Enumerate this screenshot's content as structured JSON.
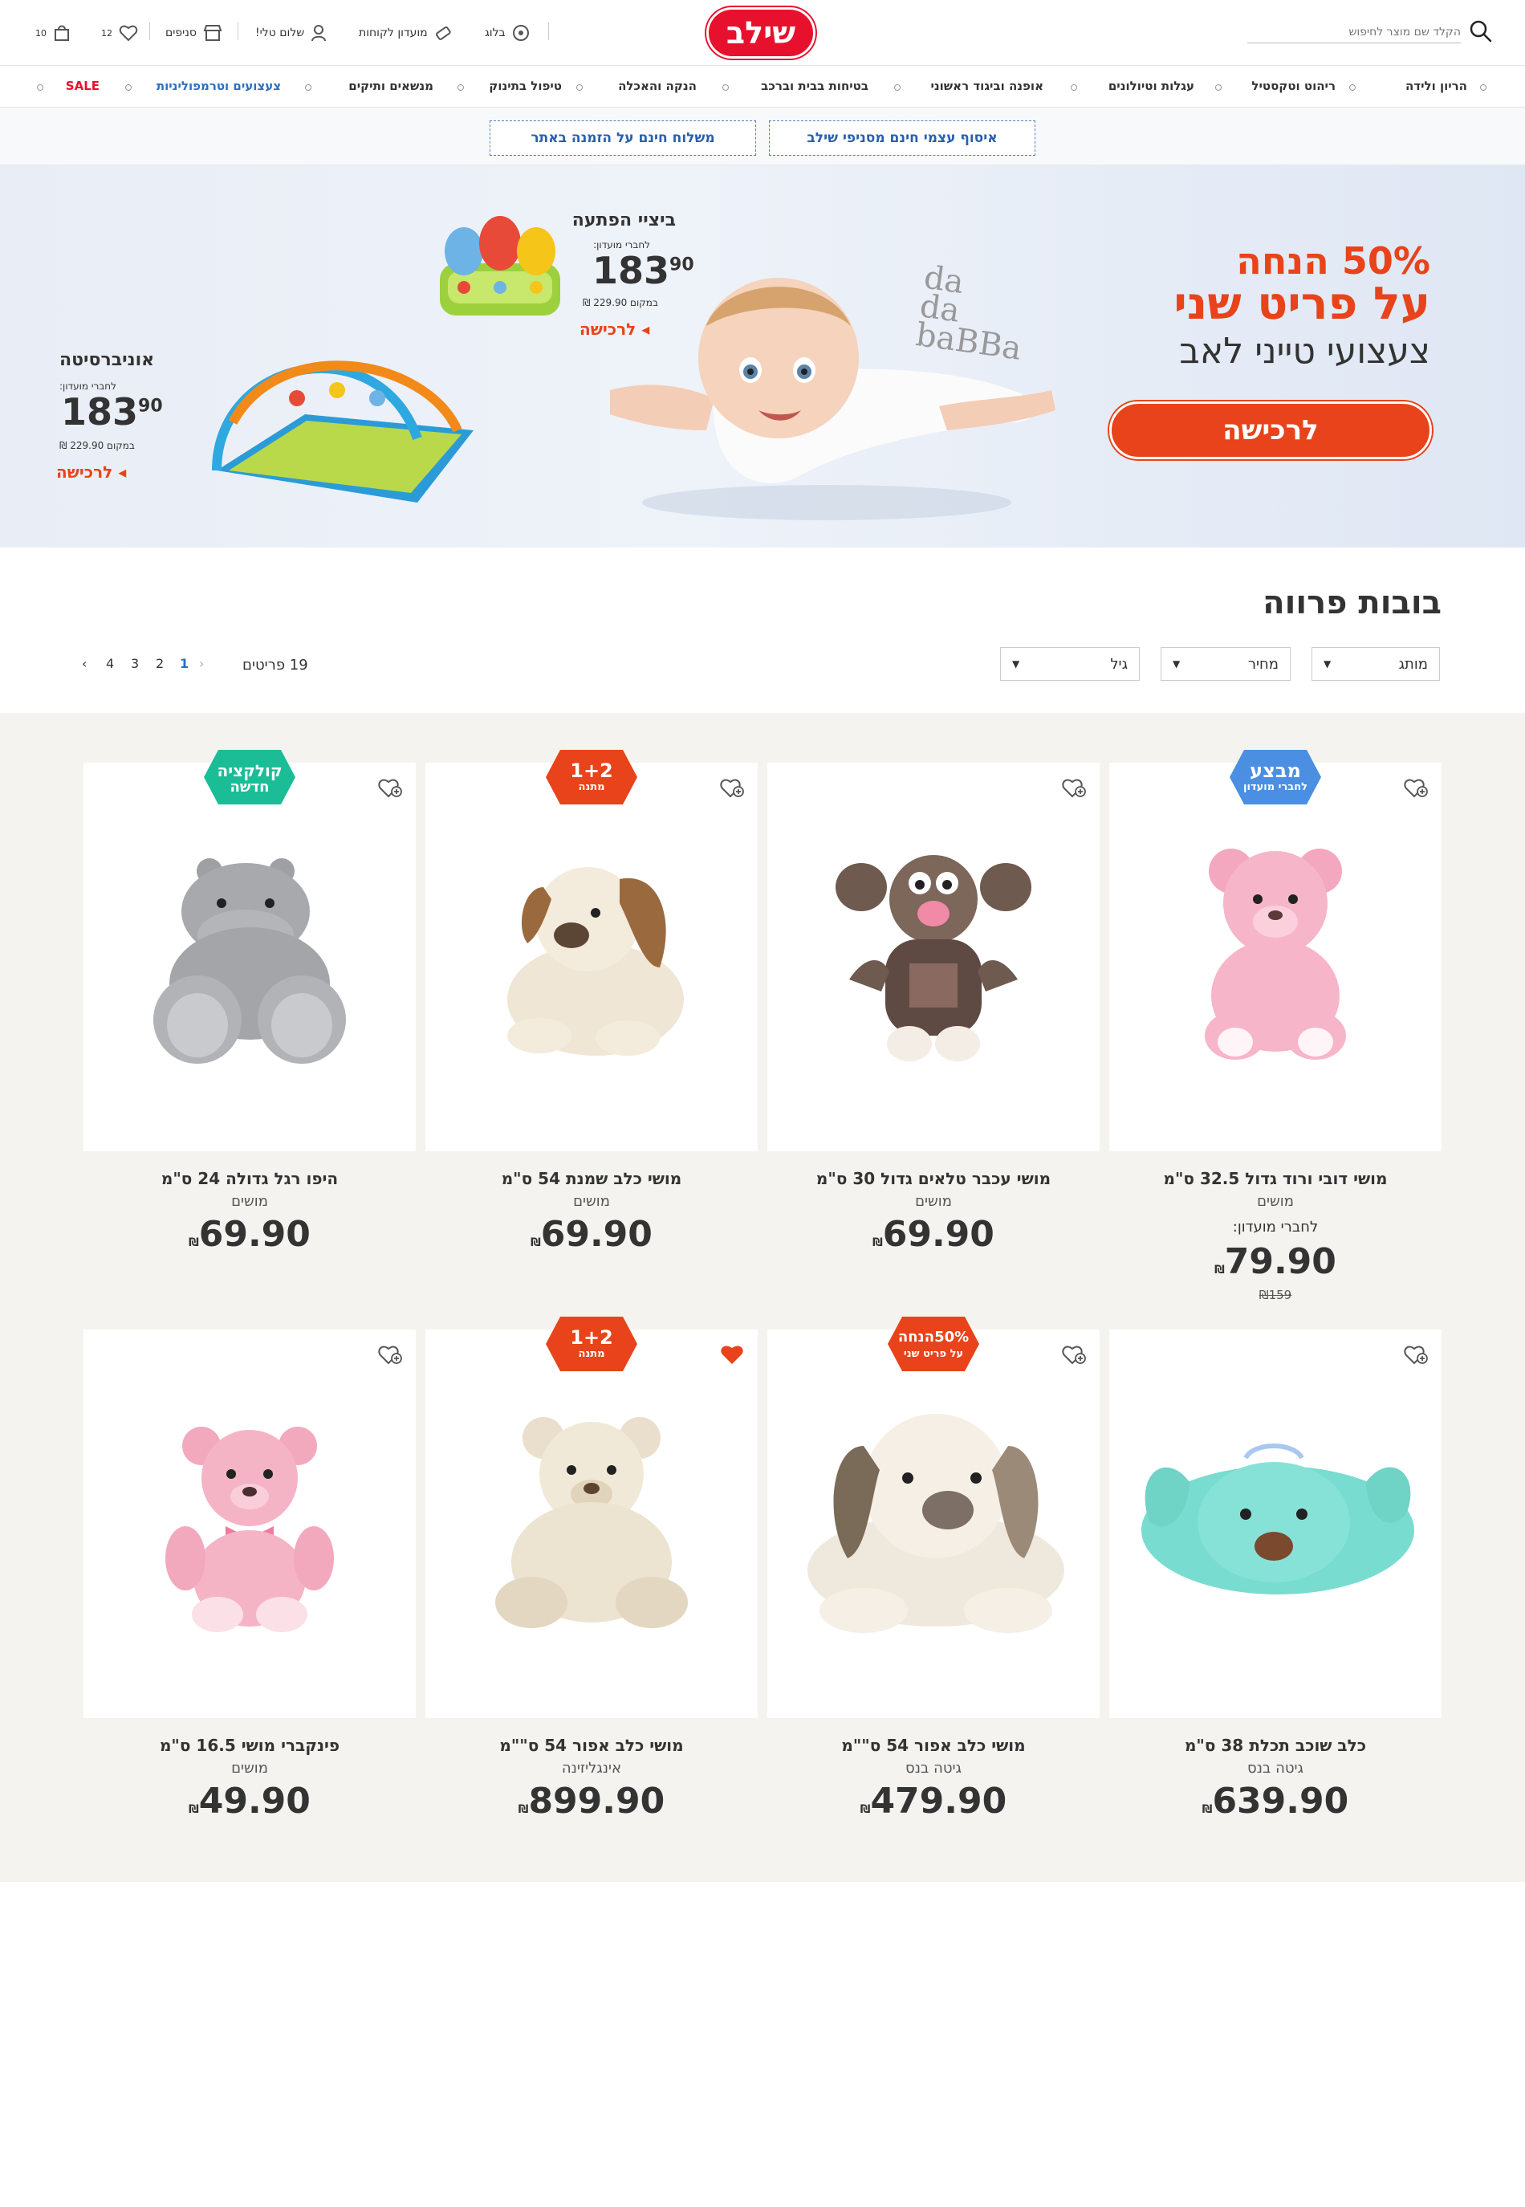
{
  "header": {
    "logo": "שילב",
    "search_placeholder": "הקלד שם מוצר לחיפוש",
    "blog": "בלוג",
    "club": "מועדון לקוחות",
    "greeting": "שלום טלי!",
    "stores": "סניפים",
    "wishlist_count": "12",
    "cart_count": "10"
  },
  "nav": {
    "items": [
      "הריון ולידה",
      "ריהוט וטקסטיל",
      "עגלות וטיולונים",
      "אופנה וביגוד ראשוני",
      "בטיחות בבית וברכב",
      "הנקה והאכלה",
      "טיפול בתינוק",
      "מנשאים ותיקים",
      "צעצועים וטרמפוליניות",
      "SALE"
    ]
  },
  "promo": {
    "pickup": "איסוף עצמי חינם מסניפי שילב",
    "shipping": "משלוח חינם על הזמנה באתר"
  },
  "hero": {
    "title_line1": "50% הנחה",
    "title_line2": "על פריט שני",
    "subtitle": "צעצועי טייני לאב",
    "cta": "לרכישה",
    "brand_logo": "da da baBBa",
    "product1": {
      "name": "ביציי הפתעה",
      "club_label": "לחברי מועדון:",
      "price_main": "183",
      "price_cents": "90",
      "instead": "במקום 229.90 ₪",
      "buy": "לרכישה"
    },
    "product2": {
      "name": "אוניברסיטה",
      "club_label": "לחברי מועדון:",
      "price_main": "183",
      "price_cents": "90",
      "instead": "במקום 229.90 ₪",
      "buy": "לרכישה"
    }
  },
  "listing": {
    "title": "בובות פרווה",
    "filters": {
      "brand": "מותג",
      "price": "מחיר",
      "age": "גיל"
    },
    "item_count": "19 פריטים",
    "pages": [
      "1",
      "2",
      "3",
      "4"
    ],
    "current_page": "1"
  },
  "products": [
    {
      "name": "מושי דובי ורוד גדול 32.5 ס\"מ",
      "brand": "מושים",
      "club_label": "לחברי מועדון:",
      "price": "79.90",
      "old_price": "159",
      "badge": {
        "l1": "מבצע",
        "l2": "לחברי מועדון",
        "color": "#4a8fe2"
      },
      "heart_filled": false
    },
    {
      "name": "מושי עכבר טלאים גדול 30 ס\"מ",
      "brand": "מושים",
      "price": "69.90",
      "badge": null,
      "heart_filled": false
    },
    {
      "name": "מושי כלב שמנת 54 ס\"מ",
      "brand": "מושים",
      "price": "69.90",
      "badge": {
        "l1": "1+2",
        "l2": "מתנה",
        "color": "#e8431a"
      },
      "heart_filled": false
    },
    {
      "name": "היפו רגל גדולה 24 ס\"מ",
      "brand": "מושים",
      "price": "69.90",
      "badge": {
        "l1": "קולקציה",
        "l2": "חדשה",
        "color": "#1bbd97"
      },
      "heart_filled": false
    },
    {
      "name": "כלב שוכב תכלת 38 ס\"מ",
      "brand": "גיטה בנס",
      "price": "639.90",
      "badge": null,
      "heart_filled": false
    },
    {
      "name": "מושי כלב אפור 54 ס\"\"מ",
      "brand": "גיטה בנס",
      "price": "479.90",
      "badge": {
        "l1": "50%הנחה",
        "l2": "על פריט שני",
        "color": "#e8431a"
      },
      "heart_filled": false
    },
    {
      "name": "מושי כלב אפור 54 ס\"\"מ",
      "brand": "אינגליזינה",
      "price": "899.90",
      "badge": {
        "l1": "1+2",
        "l2": "מתנה",
        "color": "#e8431a"
      },
      "heart_filled": true
    },
    {
      "name": "פינקברי מושי 16.5 ס\"מ",
      "brand": "מושים",
      "price": "49.90",
      "badge": null,
      "heart_filled": false
    }
  ]
}
